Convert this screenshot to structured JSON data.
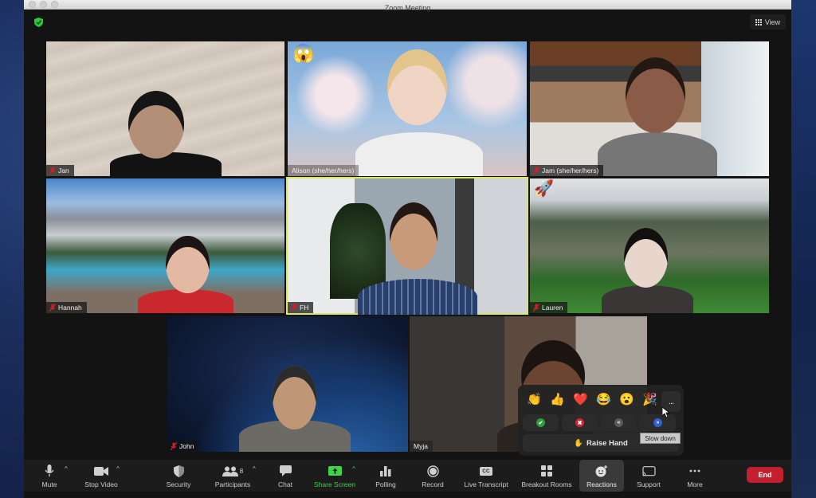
{
  "window": {
    "title": "Zoom Meeting",
    "security_badge_icon": "green-shield-check-icon",
    "view_button": {
      "icon": "grid-icon",
      "label": "View"
    }
  },
  "participants": [
    {
      "name": "Jan",
      "muted": true,
      "emoji": null,
      "active_speaker": false
    },
    {
      "name": "Alison (she/her/hers)",
      "muted": false,
      "emoji": "😱",
      "active_speaker": false
    },
    {
      "name": "Jam (she/her/hers)",
      "muted": true,
      "emoji": null,
      "active_speaker": false
    },
    {
      "name": "Hannah",
      "muted": true,
      "emoji": null,
      "active_speaker": false
    },
    {
      "name": "FH",
      "muted": true,
      "emoji": null,
      "active_speaker": true
    },
    {
      "name": "Lauren",
      "muted": true,
      "emoji": "🚀",
      "active_speaker": false
    },
    {
      "name": "John",
      "muted": true,
      "emoji": null,
      "active_speaker": false
    },
    {
      "name": "Myja",
      "muted": false,
      "emoji": null,
      "active_speaker": false
    }
  ],
  "toolbar": {
    "mute": {
      "label": "Mute",
      "icon": "microphone-icon"
    },
    "stop_video": {
      "label": "Stop Video",
      "icon": "video-camera-icon"
    },
    "security": {
      "label": "Security",
      "icon": "shield-icon"
    },
    "participants": {
      "label": "Participants",
      "icon": "people-icon",
      "count": "8"
    },
    "chat": {
      "label": "Chat",
      "icon": "chat-bubble-icon"
    },
    "share_screen": {
      "label": "Share Screen",
      "icon": "share-arrow-icon",
      "color": "#3fd24b"
    },
    "polling": {
      "label": "Polling",
      "icon": "bar-chart-icon"
    },
    "record": {
      "label": "Record",
      "icon": "record-icon"
    },
    "live_transcript": {
      "label": "Live Transcript",
      "icon": "cc-icon",
      "icon_text": "CC"
    },
    "breakout_rooms": {
      "label": "Breakout Rooms",
      "icon": "four-squares-icon"
    },
    "reactions": {
      "label": "Reactions",
      "icon": "smiley-plus-icon"
    },
    "support": {
      "label": "Support",
      "icon": "cast-screen-icon"
    },
    "more": {
      "label": "More",
      "icon": "ellipsis-icon"
    },
    "end": {
      "label": "End",
      "color": "#c41f30"
    }
  },
  "reactions_popup": {
    "emojis": [
      "👏",
      "👍",
      "❤️",
      "😂",
      "😮",
      "🎉"
    ],
    "more_label": "...",
    "feedback": [
      {
        "name": "yes",
        "glyph": "✔",
        "color": "#2e9e3c"
      },
      {
        "name": "no",
        "glyph": "✖",
        "color": "#c92a38"
      },
      {
        "name": "slow-down",
        "glyph": "«",
        "color": "#5a5a5a"
      },
      {
        "name": "speed-up",
        "glyph": "»",
        "color": "#2f5fd0"
      }
    ],
    "raise_hand": {
      "emoji": "✋",
      "label": "Raise Hand"
    },
    "tooltip": "Slow down"
  }
}
